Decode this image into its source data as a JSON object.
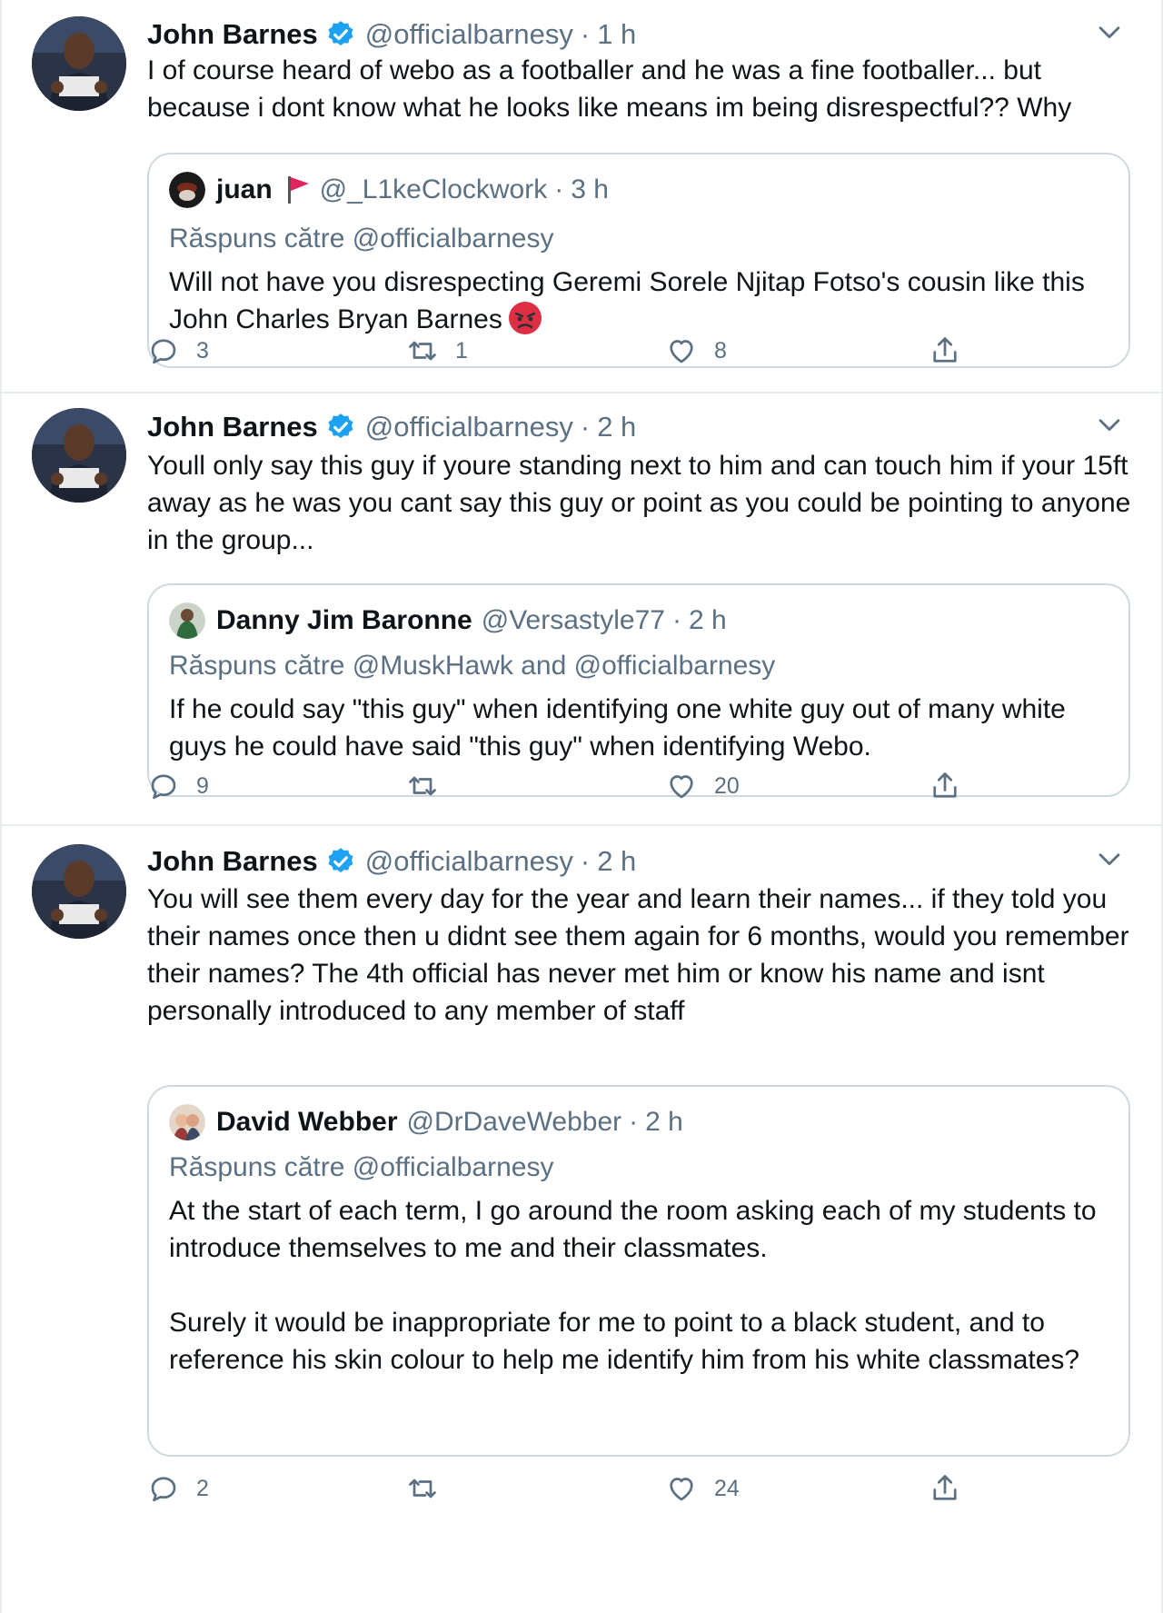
{
  "tweets": [
    {
      "author": {
        "name": "John Barnes",
        "handle": "@officialbarnesy",
        "verified": true
      },
      "time": "1 h",
      "dot": "·",
      "text": "I of course heard of webo as a footballer and he was a fine footballer... but because i dont know what he looks like means im being disrespectful?? Why",
      "quote": {
        "name": "juan",
        "handle": "@_L1keClockwork",
        "dot": "·",
        "time": "3 h",
        "reply_to": "Răspuns către @officialbarnesy",
        "text": "Will not have you disrespecting Geremi Sorele Njitap Fotso's cousin like this John Charles Bryan Barnes"
      },
      "stats": {
        "replies": "3",
        "retweets": "1",
        "likes": "8"
      }
    },
    {
      "author": {
        "name": "John Barnes",
        "handle": "@officialbarnesy",
        "verified": true
      },
      "time": "2 h",
      "dot": "·",
      "text": "Youll only say this guy if youre standing next to him and can touch him if your 15ft away as he was you cant say this guy or point as you could be pointing to anyone in the group...",
      "quote": {
        "name": "Danny Jim Baronne",
        "handle": "@Versastyle77",
        "dot": "·",
        "time": "2 h",
        "reply_to": "Răspuns către @MuskHawk and @officialbarnesy",
        "text": "If he could say \"this guy\" when identifying one white guy out of many white guys he could have said \"this guy\" when identifying Webo."
      },
      "stats": {
        "replies": "9",
        "retweets": "",
        "likes": "20"
      }
    },
    {
      "author": {
        "name": "John Barnes",
        "handle": "@officialbarnesy",
        "verified": true
      },
      "time": "2 h",
      "dot": "·",
      "text": "You will see them every day for the year and learn their names... if they told you their names once then u didnt see them again for 6 months, would you remember their names? The 4th official has never met him or know his name and isnt personally introduced to any member of staff",
      "quote": {
        "name": "David Webber",
        "handle": "@DrDaveWebber",
        "dot": "·",
        "time": "2 h",
        "reply_to": "Răspuns către @officialbarnesy",
        "text_p1": "At the start of each term, I go around the room asking each of my students to introduce themselves to me and their classmates.",
        "text_p2": "Surely it would be inappropriate for me to point to a black student, and to reference his skin colour to help me identify him from his white classmates?"
      },
      "stats": {
        "replies": "2",
        "retweets": "",
        "likes": "24"
      }
    }
  ],
  "icons": {
    "verified": "verified-badge-icon",
    "more": "chevron-down-icon",
    "reply": "reply-icon",
    "retweet": "retweet-icon",
    "like": "heart-icon",
    "share": "share-icon",
    "flag": "red-flag-icon",
    "emoji": "angry-face-icon"
  },
  "colors": {
    "accent": "#1da1f2",
    "secondary_text": "#5b7083",
    "border": "#cfd9de",
    "flag": "#e0245e"
  }
}
